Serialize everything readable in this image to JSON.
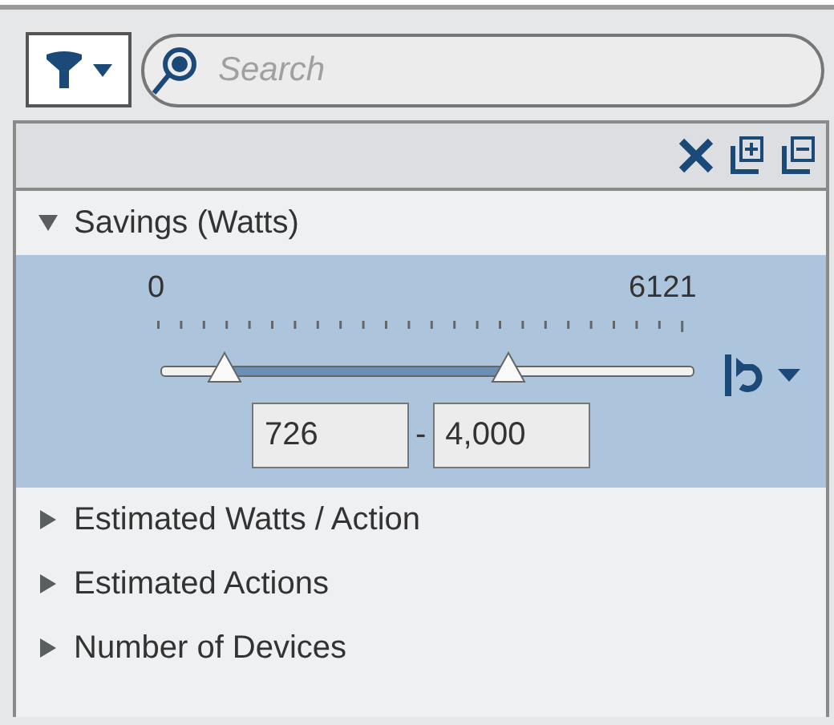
{
  "search": {
    "placeholder": "Search"
  },
  "filters": [
    {
      "label": "Savings (Watts)",
      "expanded": true,
      "range": {
        "min_label": "0",
        "max_label": "6121",
        "low": {
          "level": 0.119,
          "value": "726"
        },
        "high": {
          "level": 0.653,
          "value": "4,000"
        },
        "separator": "-"
      }
    },
    {
      "label": "Estimated Watts / Action",
      "expanded": false
    },
    {
      "label": "Estimated Actions",
      "expanded": false
    },
    {
      "label": "Number of Devices",
      "expanded": false
    }
  ]
}
